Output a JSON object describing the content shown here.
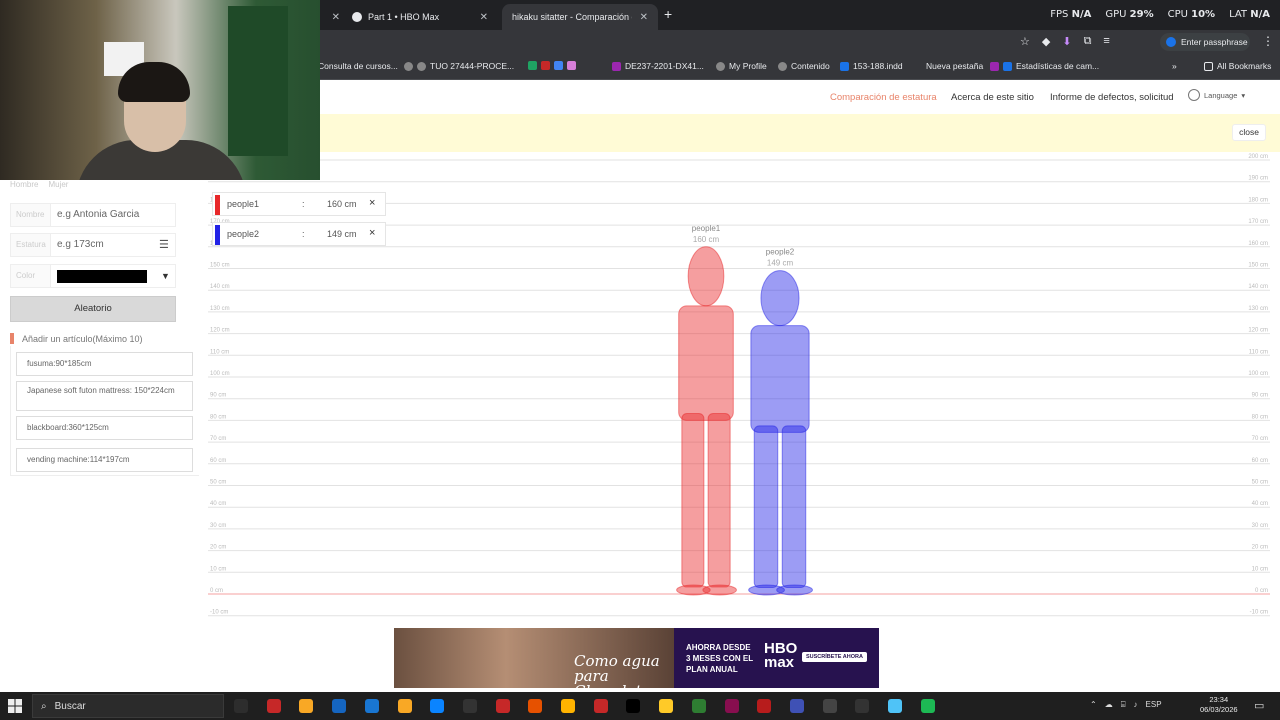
{
  "browser": {
    "tabs": [
      {
        "label": "",
        "active": false
      },
      {
        "label": "Part 1 • HBO Max",
        "active": false
      },
      {
        "label": "hikaku sitatter - Comparación d",
        "active": true
      }
    ],
    "perf": {
      "fps_label": "FPS",
      "fps": "N/A",
      "gpu_label": "GPU",
      "gpu": "29%",
      "cpu_label": "CPU",
      "cpu": "10%",
      "lat_label": "LAT",
      "lat": "N/A"
    },
    "passphrase_label": "Enter passphrase",
    "bookmarks": [
      "Consulta de cursos...",
      "TUO 27444-PROCE...",
      "DE237-2201-DX41...",
      "My Profile",
      "Contenido",
      "153-188.indd",
      "Nueva pestaña",
      "Estadísticas de cam...",
      "All Bookmarks"
    ]
  },
  "site": {
    "nav": {
      "compare": "Comparación de estatura",
      "about": "Acerca de este sitio",
      "report": "Informe de defectos, solicitud",
      "language": "Language"
    },
    "notice_close": "close",
    "form": {
      "gender": [
        "Hombre",
        "Mujer"
      ],
      "name_label": "Nombre",
      "name_placeholder": "e.g Antonia Garcia",
      "height_label": "Estatura",
      "height_placeholder": "e.g 173cm",
      "color_label": "Color",
      "random_button": "Aleatorio",
      "add_item": "Añadir un artículo(Máximo 10)",
      "items": [
        "fusuma:90*185cm",
        "Japanese soft futon mattress: 150*224cm",
        "blackboard:360*125cm",
        "vending machine:114*197cm"
      ]
    }
  },
  "chart_data": {
    "type": "height-comparison",
    "unit": "cm",
    "ylim": [
      -10,
      200
    ],
    "tick_step": 10,
    "people": [
      {
        "name": "people1",
        "height": 160,
        "height_label": "160 cm",
        "color": "#e8282a"
      },
      {
        "name": "people2",
        "height": 149,
        "height_label": "149 cm",
        "color": "#2323e6"
      }
    ],
    "separator": ":"
  },
  "ad": {
    "tagline": "Como agua para Chocolate",
    "promo": "AHORRA DESDE 3 MESES CON EL PLAN ANUAL",
    "brand": "HBO max",
    "cta": "SUSCRÍBETE AHORA"
  },
  "taskbar": {
    "search": "Buscar",
    "lang": "ESP",
    "time": "23:34",
    "date": "06/03/2026"
  }
}
